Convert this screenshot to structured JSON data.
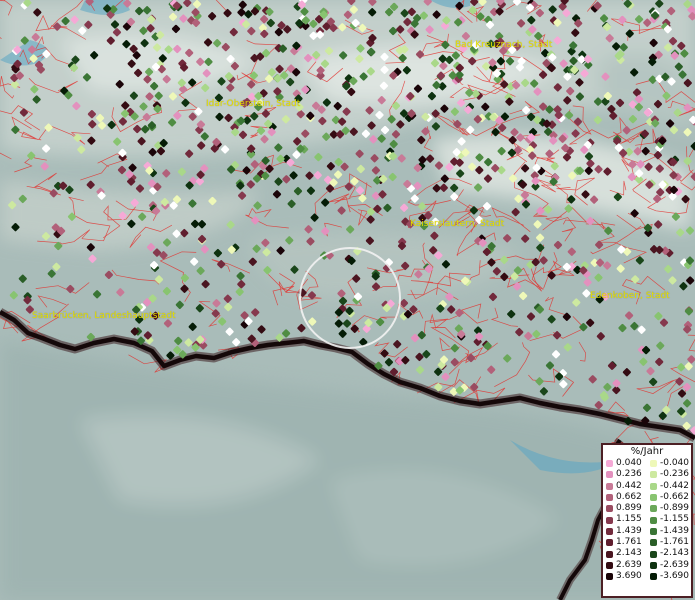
{
  "cities": [
    {
      "name": "Bad Kreuznach, Stadt",
      "id": "city-bad-kreuznach"
    },
    {
      "name": "Idar-Oberstein, Stadt",
      "id": "city-idar-oberstein"
    },
    {
      "name": "Kaiserslautern, Stadt",
      "id": "city-kaiserslautern"
    },
    {
      "name": "Edenkoben, Stadt",
      "id": "city-edenkoben"
    },
    {
      "name": "Saarbrücken, Landeshauptstadt",
      "id": "city-saarbruecken"
    }
  ],
  "legend": {
    "title": "%/Jahr",
    "positive": [
      {
        "value": "0.040",
        "color": "#f5a9d6"
      },
      {
        "value": "0.236",
        "color": "#e391be"
      },
      {
        "value": "0.442",
        "color": "#c87a97"
      },
      {
        "value": "0.662",
        "color": "#b2617a"
      },
      {
        "value": "0.899",
        "color": "#9a4c61"
      },
      {
        "value": "1.155",
        "color": "#86394e"
      },
      {
        "value": "1.439",
        "color": "#722a3c"
      },
      {
        "value": "1.761",
        "color": "#601e2e"
      },
      {
        "value": "2.143",
        "color": "#4a1520"
      },
      {
        "value": "2.639",
        "color": "#330b12"
      },
      {
        "value": "3.690",
        "color": "#1a0408"
      }
    ],
    "negative": [
      {
        "value": "-0.040",
        "color": "#eef8b8"
      },
      {
        "value": "-0.236",
        "color": "#cde9a0"
      },
      {
        "value": "-0.442",
        "color": "#a9d889"
      },
      {
        "value": "-0.662",
        "color": "#88c470"
      },
      {
        "value": "-0.899",
        "color": "#6ba85a"
      },
      {
        "value": "-1.155",
        "color": "#4f8d43"
      },
      {
        "value": "-1.439",
        "color": "#3a7535"
      },
      {
        "value": "-1.761",
        "color": "#2a5e27"
      },
      {
        "value": "-2.143",
        "color": "#1a461a"
      },
      {
        "value": "-2.639",
        "color": "#0e3210"
      },
      {
        "value": "-3.690",
        "color": "#051c06"
      }
    ]
  },
  "colors": {
    "background": "#a9bcb9",
    "boundary_lines": "#e2302c",
    "border_line": "#1a0d0f",
    "city_label": "#e7e100",
    "selection_circle": "#f2f2f2"
  }
}
